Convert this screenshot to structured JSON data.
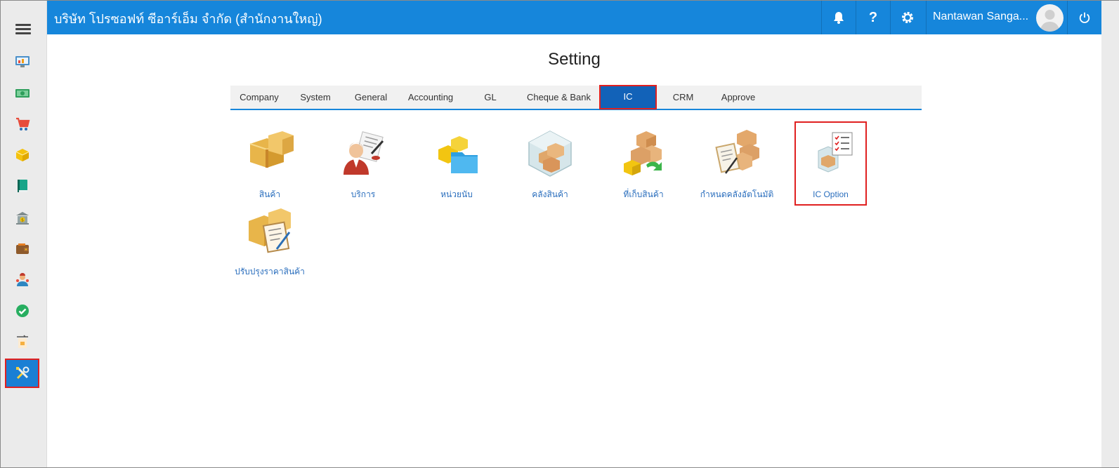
{
  "sidebar": {
    "menu_icon": "hamburger-icon",
    "items": [
      {
        "name": "dashboard",
        "icon": "monitor-chart-icon"
      },
      {
        "name": "finance",
        "icon": "cash-icon"
      },
      {
        "name": "purchase",
        "icon": "shopping-cart-icon"
      },
      {
        "name": "inventory",
        "icon": "box-icon"
      },
      {
        "name": "accounting",
        "icon": "book-icon"
      },
      {
        "name": "bank",
        "icon": "bank-icon"
      },
      {
        "name": "wallet",
        "icon": "wallet-icon"
      },
      {
        "name": "contacts",
        "icon": "people-icon"
      },
      {
        "name": "approve",
        "icon": "check-circle-icon"
      },
      {
        "name": "transfer",
        "icon": "transfer-icon"
      },
      {
        "name": "settings",
        "icon": "tools-icon",
        "active": true
      }
    ]
  },
  "header": {
    "company": "บริษัท โปรซอฟท์ ซีอาร์เอ็ม จำกัด (สำนักงานใหญ่)",
    "user_name": "Nantawan Sanga...",
    "help_label": "?"
  },
  "page": {
    "title": "Setting"
  },
  "tabs": [
    {
      "label": "Company"
    },
    {
      "label": "System"
    },
    {
      "label": "General"
    },
    {
      "label": "Accounting"
    },
    {
      "label": "GL"
    },
    {
      "label": "Cheque & Bank"
    },
    {
      "label": "IC",
      "active": true
    },
    {
      "label": "CRM"
    },
    {
      "label": "Approve"
    }
  ],
  "tiles": [
    {
      "label": "สินค้า",
      "icon": "boxes-icon"
    },
    {
      "label": "บริการ",
      "icon": "service-person-icon"
    },
    {
      "label": "หน่วยนับ",
      "icon": "unit-folder-icon"
    },
    {
      "label": "คลังสินค้า",
      "icon": "warehouse-icon"
    },
    {
      "label": "ที่เก็บสินค้า",
      "icon": "storage-location-icon"
    },
    {
      "label": "กำหนดคลังอัตโนมัติ",
      "icon": "auto-warehouse-icon"
    },
    {
      "label": "IC Option",
      "icon": "ic-option-icon",
      "selected": true
    },
    {
      "label": "ปรับปรุงราคาสินค้า",
      "icon": "price-update-icon"
    }
  ],
  "colors": {
    "topbar": "#1686db",
    "active_tab": "#1262b8",
    "highlight_border": "#e02020",
    "tile_label": "#2a6ebd"
  }
}
